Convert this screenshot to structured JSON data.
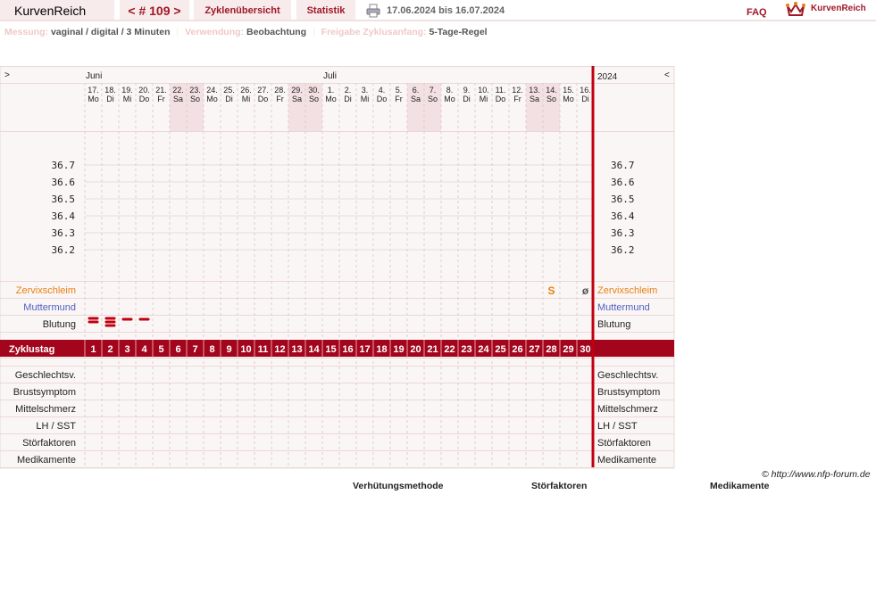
{
  "header": {
    "brand": "KurvenReich",
    "cycle": "< # 109 >",
    "tab_overview": "Zyklenübersicht",
    "tab_stats": "Statistik",
    "date_range": "17.06.2024 bis 16.07.2024",
    "faq": "FAQ",
    "logo_text": "KurvenReich",
    "accent": "#a01828"
  },
  "meta": {
    "messung_label": "Messung:",
    "messung_value": "vaginal / digital / 3 Minuten",
    "verwendung_label": "Verwendung:",
    "verwendung_value": "Beobachtung",
    "freigabe_label": "Freigabe Zyklusanfang:",
    "freigabe_value": "5-Tage-Regel"
  },
  "chart": {
    "nav_left": ">",
    "nav_right": "<",
    "year": "2024",
    "months": [
      {
        "label": "Juni",
        "col": 0
      },
      {
        "label": "Juli",
        "col": 14
      }
    ],
    "days": [
      [
        "17.",
        "Mo"
      ],
      [
        "18.",
        "Di"
      ],
      [
        "19.",
        "Mi"
      ],
      [
        "20.",
        "Do"
      ],
      [
        "21.",
        "Fr"
      ],
      [
        "22.",
        "Sa"
      ],
      [
        "23.",
        "So"
      ],
      [
        "24.",
        "Mo"
      ],
      [
        "25.",
        "Di"
      ],
      [
        "26.",
        "Mi"
      ],
      [
        "27.",
        "Do"
      ],
      [
        "28.",
        "Fr"
      ],
      [
        "29.",
        "Sa"
      ],
      [
        "30.",
        "So"
      ],
      [
        "1.",
        "Mo"
      ],
      [
        "2.",
        "Di"
      ],
      [
        "3.",
        "Mi"
      ],
      [
        "4.",
        "Do"
      ],
      [
        "5.",
        "Fr"
      ],
      [
        "6.",
        "Sa"
      ],
      [
        "7.",
        "So"
      ],
      [
        "8.",
        "Mo"
      ],
      [
        "9.",
        "Di"
      ],
      [
        "10.",
        "Mi"
      ],
      [
        "11.",
        "Do"
      ],
      [
        "12.",
        "Fr"
      ],
      [
        "13.",
        "Sa"
      ],
      [
        "14.",
        "So"
      ],
      [
        "15.",
        "Mo"
      ],
      [
        "16.",
        "Di"
      ]
    ],
    "temp_labels": [
      "36.7",
      "36.6",
      "36.5",
      "36.4",
      "36.3",
      "36.2"
    ],
    "rows_top": [
      {
        "label": "Zervixschleim",
        "color": "#e88010"
      },
      {
        "label": "Muttermund",
        "color": "#5060c0"
      },
      {
        "label": "Blutung",
        "color": "#222"
      }
    ],
    "zyklustag_label": "Zyklustag",
    "cycle_days": [
      "1",
      "2",
      "3",
      "4",
      "5",
      "6",
      "7",
      "8",
      "9",
      "10",
      "11",
      "12",
      "13",
      "14",
      "15",
      "16",
      "17",
      "18",
      "19",
      "20",
      "21",
      "22",
      "23",
      "24",
      "25",
      "26",
      "27",
      "28",
      "29",
      "30"
    ],
    "rows_bottom": [
      "Geschlechtsv.",
      "Brustsymptom",
      "Mittelschmerz",
      "LH / SST",
      "Störfaktoren",
      "Medikamente"
    ],
    "cervix_marks": [
      {
        "col": 27,
        "text": "S",
        "color": "#e88010"
      },
      {
        "col": 29,
        "text": "ø",
        "color": "#555"
      }
    ],
    "bleeding": [
      {
        "col": 0,
        "level": 2
      },
      {
        "col": 1,
        "level": 3
      },
      {
        "col": 2,
        "level": 1
      },
      {
        "col": 3,
        "level": 1
      }
    ]
  },
  "footer": {
    "copyright": "© http://www.nfp-forum.de",
    "legend": [
      "Verhütungsmethode",
      "Störfaktoren",
      "Medikamente"
    ]
  }
}
